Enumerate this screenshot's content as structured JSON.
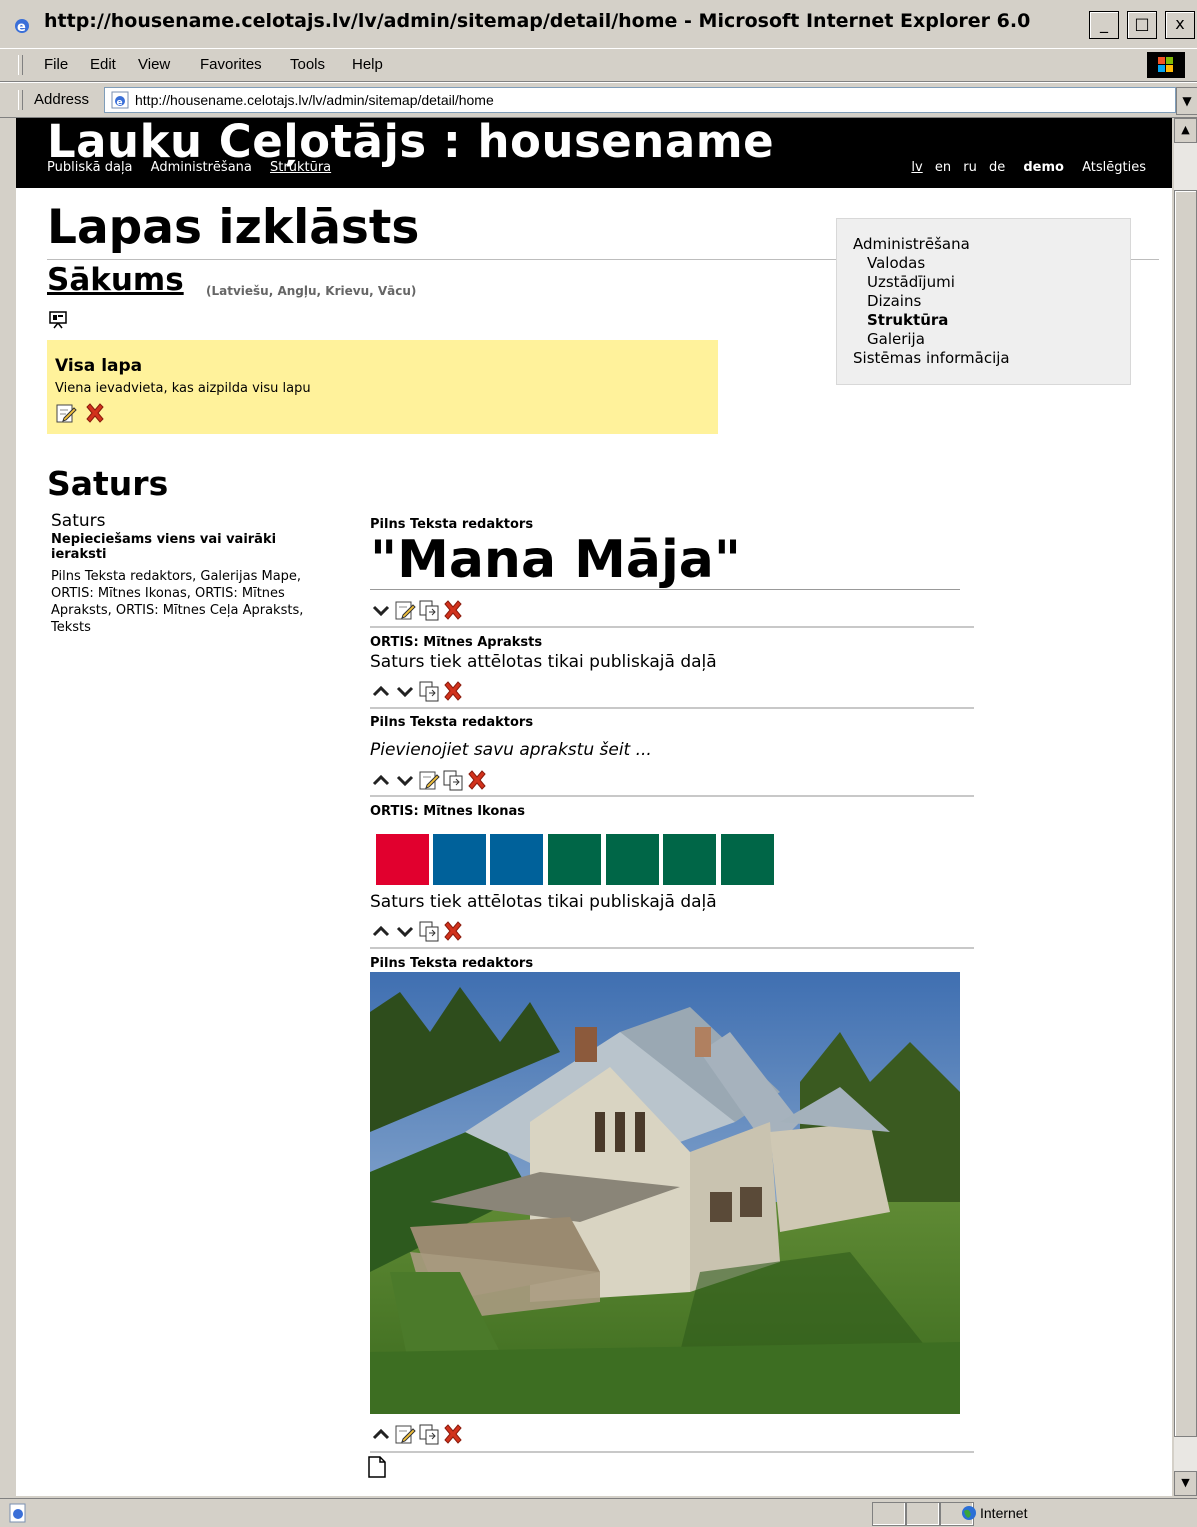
{
  "window": {
    "title": "http://housename.celotajs.lv/lv/admin/sitemap/detail/home - Microsoft Internet Explorer 6.0",
    "controls": [
      "_",
      "□",
      "x"
    ]
  },
  "menu": [
    "File",
    "Edit",
    "View",
    "Favorites",
    "Tools",
    "Help"
  ],
  "address": {
    "label": "Address",
    "url": "http://housename.celotajs.lv/lv/admin/sitemap/detail/home"
  },
  "status": {
    "zone": "Internet"
  },
  "header": {
    "site_title": "Lauku Ceļotājs : housename",
    "nav": [
      "Publiskā daļa",
      "Administrēšana",
      "Struktūra"
    ],
    "langs": [
      "lv",
      "en",
      "ru",
      "de"
    ],
    "user": "demo",
    "logout": "Atslēgties"
  },
  "page": {
    "title": "Lapas izklāsts",
    "node_title": "Sākums",
    "node_langs": "(Latviešu, Angļu, Krievu, Vācu)"
  },
  "layout_box": {
    "title": "Visa lapa",
    "description": "Viena ievadvieta, kas aizpilda visu lapu"
  },
  "sidebar": {
    "items": [
      {
        "label": "Administrēšana",
        "level": 0,
        "active": false
      },
      {
        "label": "Valodas",
        "level": 1,
        "active": false
      },
      {
        "label": "Uzstādījumi",
        "level": 1,
        "active": false
      },
      {
        "label": "Dizains",
        "level": 1,
        "active": false
      },
      {
        "label": "Struktūra",
        "level": 1,
        "active": true
      },
      {
        "label": "Galerija",
        "level": 1,
        "active": false
      },
      {
        "label": "Sistēmas informācija",
        "level": 0,
        "active": false
      }
    ]
  },
  "content": {
    "heading": "Saturs",
    "left": {
      "title": "Saturs",
      "required": "Nepieciešams viens vai vairāki ieraksti",
      "types": "Pilns Teksta redaktors, Galerijas Mape, ORTIS: Mītnes Ikonas, ORTIS: Mītnes Apraksts, ORTIS: Mītnes Ceļa Apraksts, Teksts"
    },
    "blocks": [
      {
        "type": "Pilns Teksta redaktors",
        "text": "\"Mana Māja\""
      },
      {
        "type": "ORTIS: Mītnes Apraksts",
        "text": "Saturs tiek attēlotas tikai publiskajā daļā"
      },
      {
        "type": "Pilns Teksta redaktors",
        "text": "Pievienojiet savu aprakstu šeit ..."
      },
      {
        "type": "ORTIS: Mītnes Ikonas",
        "text": "Saturs tiek attēlotas tikai publiskajā daļā"
      },
      {
        "type": "Pilns Teksta redaktors",
        "text": ""
      }
    ],
    "icon_colors": [
      "#e1002e",
      "#00619a",
      "#00619a",
      "#006647",
      "#006647",
      "#006647",
      "#006647"
    ]
  }
}
